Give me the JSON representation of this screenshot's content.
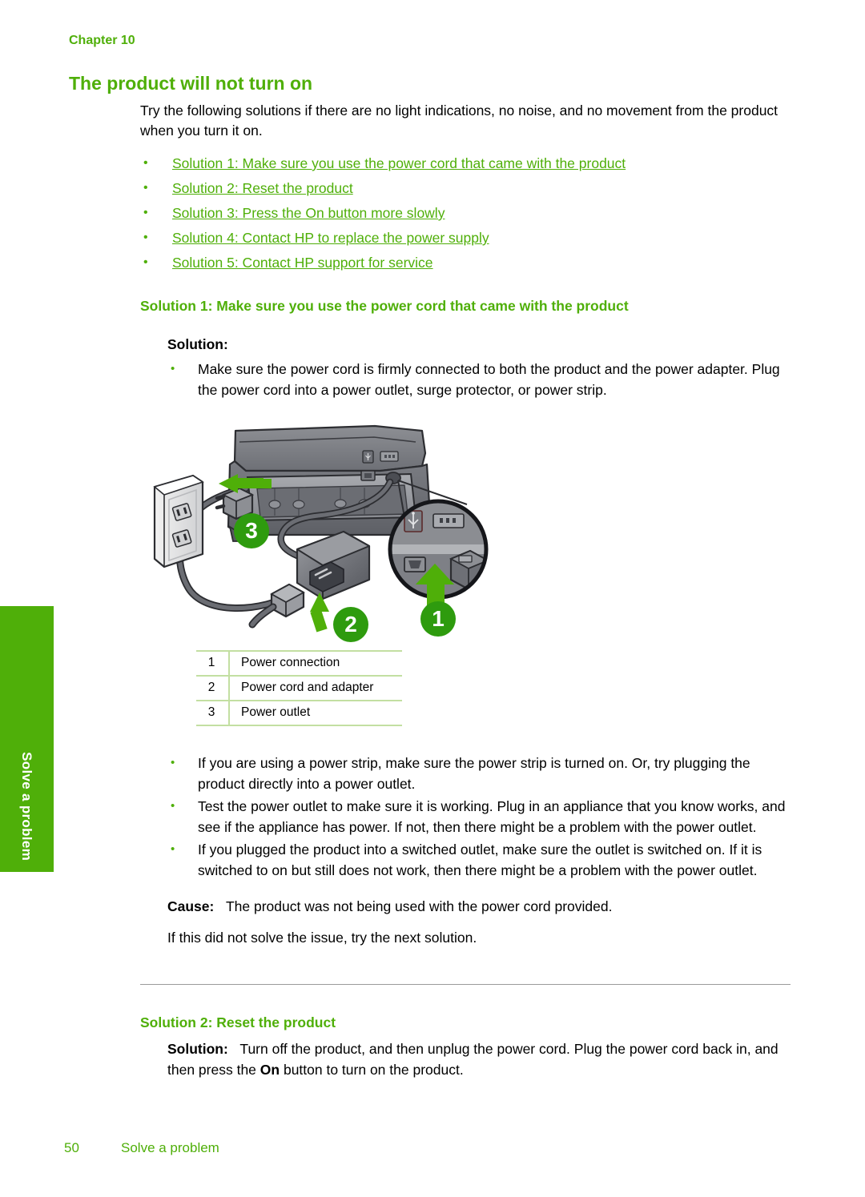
{
  "colors": {
    "brand_green": "#4FAF09",
    "table_border_green": "#C3DFA2",
    "body_text": "#000000",
    "rule_gray": "#9a9a9a"
  },
  "side_tab": {
    "label": "Solve a problem"
  },
  "header": {
    "chapter": "Chapter 10"
  },
  "page_title": "The product will not turn on",
  "intro": "Try the following solutions if there are no light indications, no noise, and no movement from the product when you turn it on.",
  "solution_links": [
    "Solution 1: Make sure you use the power cord that came with the product",
    "Solution 2: Reset the product",
    "Solution 3: Press the On button more slowly",
    "Solution 4: Contact HP to replace the power supply",
    "Solution 5: Contact HP support for service"
  ],
  "solution1": {
    "heading": "Solution 1: Make sure you use the power cord that came with the product",
    "solution_label": "Solution:",
    "bullets_before_figure": [
      "Make sure the power cord is firmly connected to both the product and the power adapter. Plug the power cord into a power outlet, surge protector, or power strip."
    ],
    "figure": {
      "name": "printer-power-connection-diagram",
      "callouts": [
        "1",
        "2",
        "3"
      ],
      "legend_rows": [
        {
          "num": "1",
          "desc": "Power connection"
        },
        {
          "num": "2",
          "desc": "Power cord and adapter"
        },
        {
          "num": "3",
          "desc": "Power outlet"
        }
      ]
    },
    "bullets_after_figure": [
      "If you are using a power strip, make sure the power strip is turned on. Or, try plugging the product directly into a power outlet.",
      "Test the power outlet to make sure it is working. Plug in an appliance that you know works, and see if the appliance has power. If not, then there might be a problem with the power outlet.",
      "If you plugged the product into a switched outlet, make sure the outlet is switched on. If it is switched to on but still does not work, then there might be a problem with the power outlet."
    ],
    "cause_label": "Cause:",
    "cause_text": "The product was not being used with the power cord provided.",
    "next_text": "If this did not solve the issue, try the next solution."
  },
  "solution2": {
    "heading": "Solution 2: Reset the product",
    "solution_label": "Solution:",
    "text_part1": "Turn off the product, and then unplug the power cord. Plug the power cord back in, and then press the ",
    "emphasis": "On",
    "text_part2": " button to turn on the product."
  },
  "footer": {
    "page_number": "50",
    "section": "Solve a problem"
  }
}
